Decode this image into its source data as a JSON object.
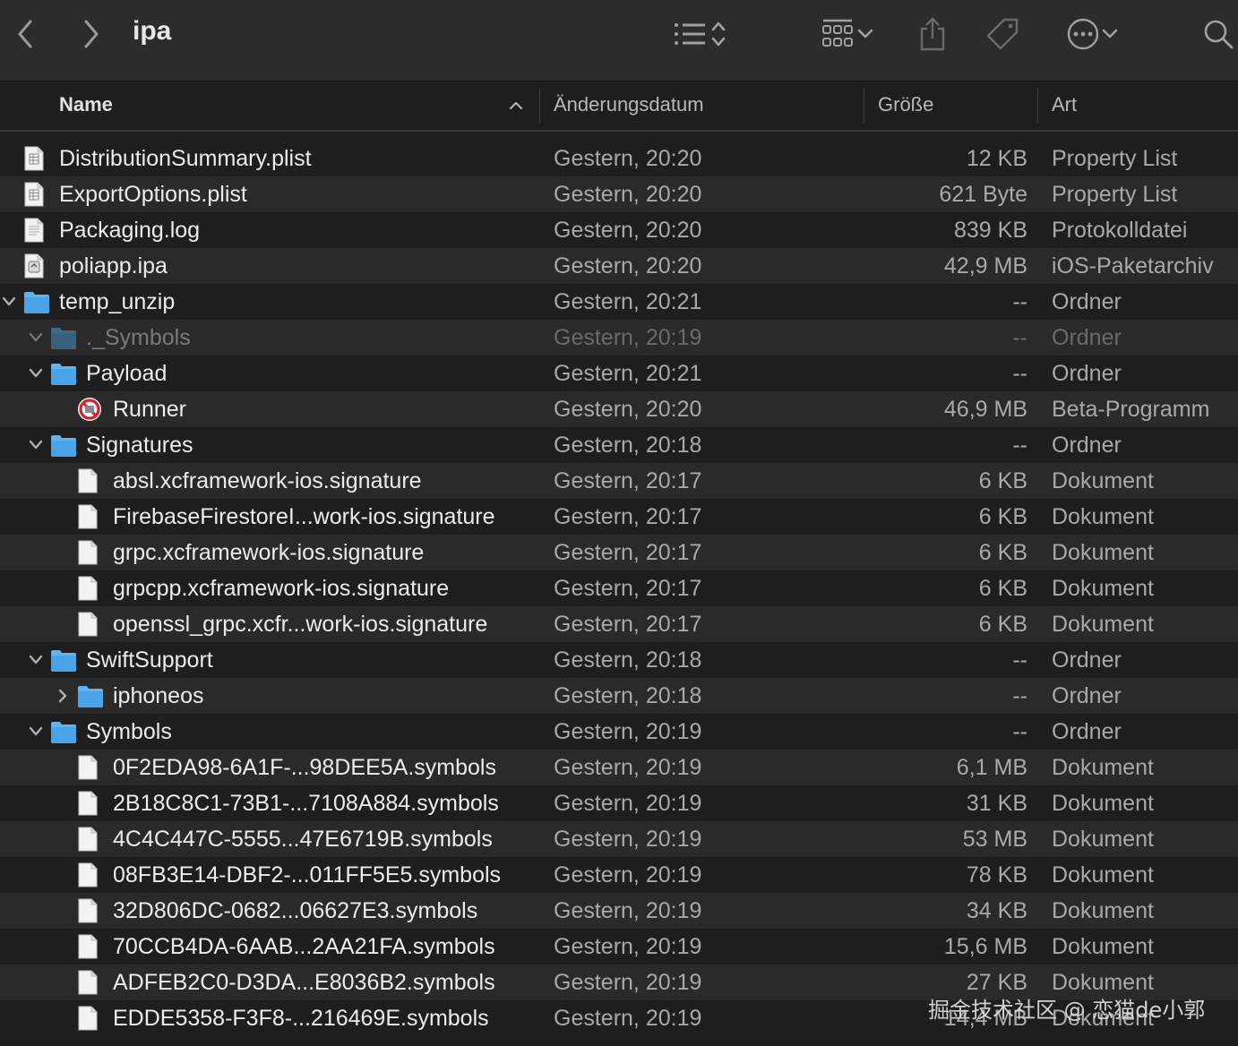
{
  "window": {
    "title": "ipa"
  },
  "toolbar": {
    "back_icon": "chevron-left-icon",
    "forward_icon": "chevron-right-icon",
    "list_view_icon": "list-icon",
    "sort_icon": "updown-chevron-icon",
    "gallery_icon": "grid-icon",
    "share_icon": "share-icon",
    "tag_icon": "tag-icon",
    "more_icon": "ellipsis-circle-icon",
    "search_icon": "search-icon"
  },
  "columns": {
    "name": "Name",
    "date": "Änderungsdatum",
    "size": "Größe",
    "kind": "Art"
  },
  "rows": [
    {
      "name": "DistributionSummary.plist",
      "date": "Gestern, 20:20",
      "size": "12 KB",
      "kind": "Property List",
      "depth": 0,
      "icon": "plist-icon",
      "expand": "none"
    },
    {
      "name": "ExportOptions.plist",
      "date": "Gestern, 20:20",
      "size": "621 Byte",
      "kind": "Property List",
      "depth": 0,
      "icon": "plist-icon",
      "expand": "none"
    },
    {
      "name": "Packaging.log",
      "date": "Gestern, 20:20",
      "size": "839 KB",
      "kind": "Protokolldatei",
      "depth": 0,
      "icon": "log-icon",
      "expand": "none"
    },
    {
      "name": "poliapp.ipa",
      "date": "Gestern, 20:20",
      "size": "42,9 MB",
      "kind": "iOS-Paketarchiv",
      "depth": 0,
      "icon": "archive-icon",
      "expand": "none"
    },
    {
      "name": "temp_unzip",
      "date": "Gestern, 20:21",
      "size": "--",
      "kind": "Ordner",
      "depth": 0,
      "icon": "folder-icon",
      "expand": "open"
    },
    {
      "name": "._Symbols",
      "date": "Gestern, 20:19",
      "size": "--",
      "kind": "Ordner",
      "depth": 1,
      "icon": "folder-icon",
      "expand": "open",
      "dim": true
    },
    {
      "name": "Payload",
      "date": "Gestern, 20:21",
      "size": "--",
      "kind": "Ordner",
      "depth": 1,
      "icon": "folder-icon",
      "expand": "open"
    },
    {
      "name": "Runner",
      "date": "Gestern, 20:20",
      "size": "46,9 MB",
      "kind": "Beta-Programm",
      "depth": 2,
      "icon": "blocked-app-icon",
      "expand": "none"
    },
    {
      "name": "Signatures",
      "date": "Gestern, 20:18",
      "size": "--",
      "kind": "Ordner",
      "depth": 1,
      "icon": "folder-icon",
      "expand": "open"
    },
    {
      "name": "absl.xcframework-ios.signature",
      "date": "Gestern, 20:17",
      "size": "6 KB",
      "kind": "Dokument",
      "depth": 2,
      "icon": "document-icon",
      "expand": "none"
    },
    {
      "name": "FirebaseFirestoreI...work-ios.signature",
      "date": "Gestern, 20:17",
      "size": "6 KB",
      "kind": "Dokument",
      "depth": 2,
      "icon": "document-icon",
      "expand": "none"
    },
    {
      "name": "grpc.xcframework-ios.signature",
      "date": "Gestern, 20:17",
      "size": "6 KB",
      "kind": "Dokument",
      "depth": 2,
      "icon": "document-icon",
      "expand": "none"
    },
    {
      "name": "grpcpp.xcframework-ios.signature",
      "date": "Gestern, 20:17",
      "size": "6 KB",
      "kind": "Dokument",
      "depth": 2,
      "icon": "document-icon",
      "expand": "none"
    },
    {
      "name": "openssl_grpc.xcfr...work-ios.signature",
      "date": "Gestern, 20:17",
      "size": "6 KB",
      "kind": "Dokument",
      "depth": 2,
      "icon": "document-icon",
      "expand": "none"
    },
    {
      "name": "SwiftSupport",
      "date": "Gestern, 20:18",
      "size": "--",
      "kind": "Ordner",
      "depth": 1,
      "icon": "folder-icon",
      "expand": "open"
    },
    {
      "name": "iphoneos",
      "date": "Gestern, 20:18",
      "size": "--",
      "kind": "Ordner",
      "depth": 2,
      "icon": "folder-icon",
      "expand": "closed"
    },
    {
      "name": "Symbols",
      "date": "Gestern, 20:19",
      "size": "--",
      "kind": "Ordner",
      "depth": 1,
      "icon": "folder-icon",
      "expand": "open"
    },
    {
      "name": "0F2EDA98-6A1F-...98DEE5A.symbols",
      "date": "Gestern, 20:19",
      "size": "6,1 MB",
      "kind": "Dokument",
      "depth": 2,
      "icon": "document-icon",
      "expand": "none"
    },
    {
      "name": "2B18C8C1-73B1-...7108A884.symbols",
      "date": "Gestern, 20:19",
      "size": "31 KB",
      "kind": "Dokument",
      "depth": 2,
      "icon": "document-icon",
      "expand": "none"
    },
    {
      "name": "4C4C447C-5555...47E6719B.symbols",
      "date": "Gestern, 20:19",
      "size": "53 MB",
      "kind": "Dokument",
      "depth": 2,
      "icon": "document-icon",
      "expand": "none"
    },
    {
      "name": "08FB3E14-DBF2-...011FF5E5.symbols",
      "date": "Gestern, 20:19",
      "size": "78 KB",
      "kind": "Dokument",
      "depth": 2,
      "icon": "document-icon",
      "expand": "none"
    },
    {
      "name": "32D806DC-0682...06627E3.symbols",
      "date": "Gestern, 20:19",
      "size": "34 KB",
      "kind": "Dokument",
      "depth": 2,
      "icon": "document-icon",
      "expand": "none"
    },
    {
      "name": "70CCB4DA-6AAB...2AA21FA.symbols",
      "date": "Gestern, 20:19",
      "size": "15,6 MB",
      "kind": "Dokument",
      "depth": 2,
      "icon": "document-icon",
      "expand": "none"
    },
    {
      "name": "ADFEB2C0-D3DA...E8036B2.symbols",
      "date": "Gestern, 20:19",
      "size": "27 KB",
      "kind": "Dokument",
      "depth": 2,
      "icon": "document-icon",
      "expand": "none"
    },
    {
      "name": "EDDE5358-F3F8-...216469E.symbols",
      "date": "Gestern, 20:19",
      "size": "14,4 MB",
      "kind": "Dokument",
      "depth": 2,
      "icon": "document-icon",
      "expand": "none"
    }
  ],
  "watermark": "掘金技术社区 @ 恋猫de小郭",
  "colors": {
    "folder": "#5fb3f0",
    "background": "#1e1e1e",
    "row_alt": "#2a2a2a",
    "toolbar": "#2c2c2c"
  }
}
